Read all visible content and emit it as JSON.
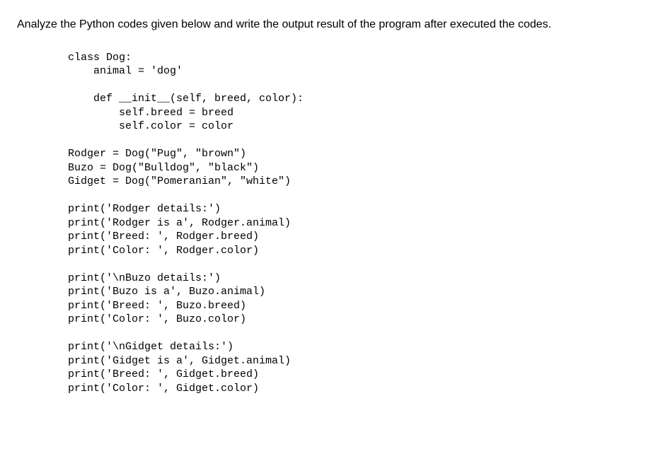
{
  "instruction": "Analyze the Python codes given below and write the output result of the program after executed the codes.",
  "code": {
    "line1": "class Dog:",
    "line2": "    animal = 'dog'",
    "line3": "",
    "line4": "    def __init__(self, breed, color):",
    "line5": "        self.breed = breed",
    "line6": "        self.color = color",
    "line7": "",
    "line8": "Rodger = Dog(\"Pug\", \"brown\")",
    "line9": "Buzo = Dog(\"Bulldog\", \"black\")",
    "line10": "Gidget = Dog(\"Pomeranian\", \"white\")",
    "line11": "",
    "line12": "print('Rodger details:')",
    "line13": "print('Rodger is a', Rodger.animal)",
    "line14": "print('Breed: ', Rodger.breed)",
    "line15": "print('Color: ', Rodger.color)",
    "line16": "",
    "line17": "print('\\nBuzo details:')",
    "line18": "print('Buzo is a', Buzo.animal)",
    "line19": "print('Breed: ', Buzo.breed)",
    "line20": "print('Color: ', Buzo.color)",
    "line21": "",
    "line22": "print('\\nGidget details:')",
    "line23": "print('Gidget is a', Gidget.animal)",
    "line24": "print('Breed: ', Gidget.breed)",
    "line25": "print('Color: ', Gidget.color)"
  }
}
